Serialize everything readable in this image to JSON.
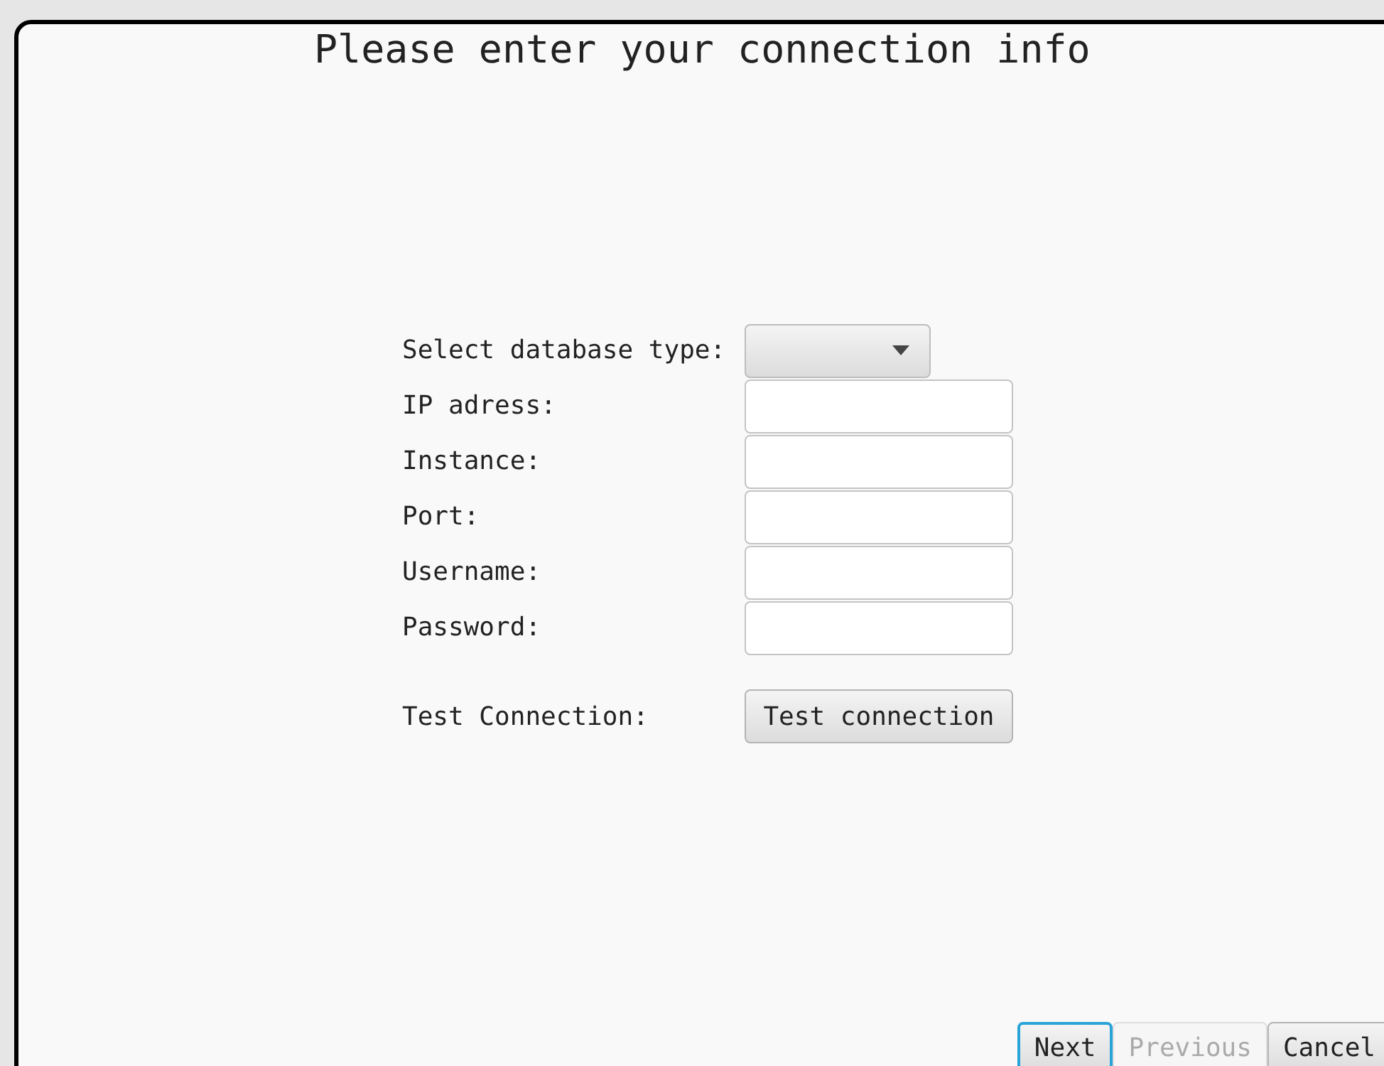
{
  "title": "Please enter your connection info",
  "form": {
    "rows": [
      {
        "label": "Select database type:",
        "kind": "dropdown"
      },
      {
        "label": "IP adress:",
        "kind": "text"
      },
      {
        "label": "Instance:",
        "kind": "text"
      },
      {
        "label": "Port:",
        "kind": "text"
      },
      {
        "label": "Username:",
        "kind": "text"
      },
      {
        "label": "Password:",
        "kind": "text"
      },
      {
        "label": "Test Connection:",
        "kind": "button",
        "button_label": "Test connection"
      }
    ]
  },
  "buttons": [
    {
      "label": "Next",
      "disabled": false,
      "focused": true
    },
    {
      "label": "Previous",
      "disabled": true,
      "focused": false
    },
    {
      "label": "Cancel",
      "disabled": false,
      "focused": false
    }
  ]
}
